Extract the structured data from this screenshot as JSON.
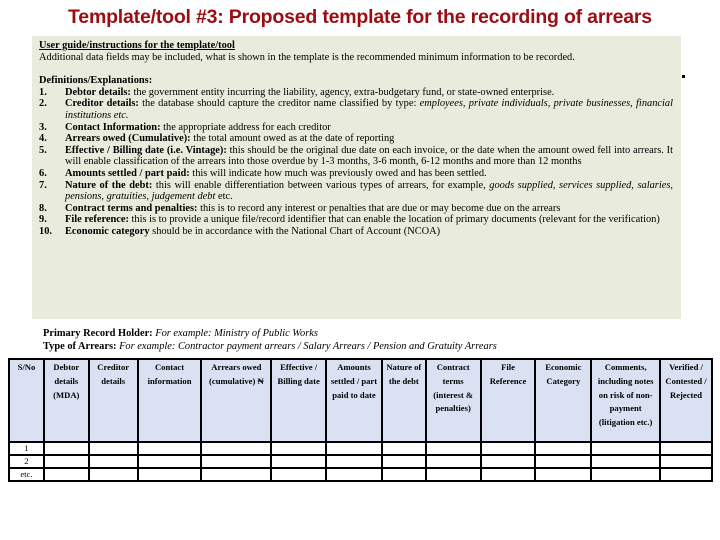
{
  "title": "Template/tool #3: Proposed template for the recording of arrears",
  "guide": {
    "heading": "User guide/instructions for the template/tool",
    "intro": "Additional data fields may be included, what is shown in the template is the recommended minimum information to be recorded.",
    "definitions_heading": "Definitions/Explanations:",
    "definitions": [
      {
        "num": "1.",
        "term": "Debtor details:",
        "text": " the government entity incurring the liability, agency, extra-budgetary fund, or state-owned enterprise.",
        "italic": ""
      },
      {
        "num": "2.",
        "term": "Creditor details:",
        "text": " the database should capture the creditor name classified by type: ",
        "italic": "employees, private individuals, private businesses, financial institutions etc."
      },
      {
        "num": "3.",
        "term": "Contact Information:",
        "text": " the appropriate address for each creditor",
        "italic": ""
      },
      {
        "num": "4.",
        "term": "Arrears owed (Cumulative):",
        "text": " the total amount owed as at the date of reporting",
        "italic": ""
      },
      {
        "num": "5.",
        "term": "Effective / Billing date (i.e. Vintage):",
        "text": " this should be the original due date on each invoice, or the date when the amount owed fell into arrears. It will enable classification of the arrears into those overdue by 1-3 months, 3-6 month, 6-12 months and more than 12 months",
        "italic": ""
      },
      {
        "num": "6.",
        "term": "Amounts settled / part paid:",
        "text": " this will indicate how much was previously owed and has been settled.",
        "italic": ""
      },
      {
        "num": "7.",
        "term": "Nature of the debt:",
        "text": " this will enable differentiation between various types of arrears, for example, ",
        "italic": "goods supplied, services supplied, salaries, pensions, gratuities, judgement debt",
        "after": " etc."
      },
      {
        "num": "8.",
        "term": "Contract terms and penalties:",
        "text": " this is to record any interest or penalties that are due or may become due on the arrears",
        "italic": ""
      },
      {
        "num": "9.",
        "term": "File reference:",
        "text": " this is to provide a unique file/record identifier that can enable the location of primary documents (relevant for the verification)",
        "italic": ""
      },
      {
        "num": "10.",
        "term": "Economic category",
        "text": " should be in accordance with the National Chart of Account (NCOA)",
        "italic": ""
      }
    ]
  },
  "record_info": {
    "holder_label": "Primary Record Holder:",
    "holder_value": " For example: Ministry of Public Works",
    "type_label": "Type of Arrears:",
    "type_value": " For example: Contractor payment arrears / Salary Arrears / Pension and Gratuity Arrears"
  },
  "table": {
    "headers": [
      "S/No",
      "Debtor details (MDA)",
      "Creditor details",
      "Contact information",
      "Arrears owed (cumulative) ₦",
      "Effective / Billing date",
      "Amounts settled / part paid to date",
      "Nature of the debt",
      "Contract terms (interest & penalties)",
      "File Reference",
      "Economic Category",
      "Comments, including notes on risk of non-payment (litigation etc.)",
      "Verified / Contested / Rejected"
    ],
    "rows": [
      [
        "1",
        "",
        "",
        "",
        "",
        "",
        "",
        "",
        "",
        "",
        "",
        "",
        ""
      ],
      [
        "2",
        "",
        "",
        "",
        "",
        "",
        "",
        "",
        "",
        "",
        "",
        "",
        ""
      ],
      [
        "etc.",
        "",
        "",
        "",
        "",
        "",
        "",
        "",
        "",
        "",
        "",
        "",
        ""
      ]
    ]
  },
  "colors": {
    "title": "#9b0d12",
    "guide_background": "#e9ecdc",
    "table_header_background": "#d9e1f2"
  }
}
